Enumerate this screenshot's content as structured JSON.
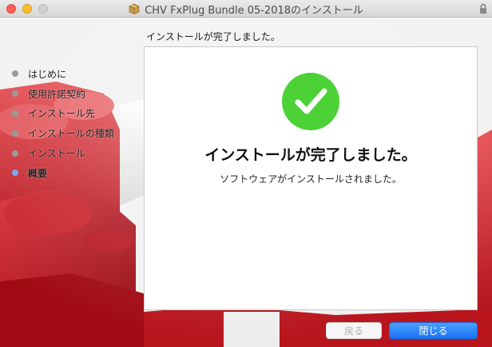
{
  "window": {
    "title": "CHV FxPlug Bundle 05-2018のインストール"
  },
  "colors": {
    "accent": "#1a72f6",
    "success": "#4cd137",
    "brand_red": "#c8141e",
    "active_dot": "#7aa7f5"
  },
  "header": {
    "step_title": "インストールが完了しました。"
  },
  "sidebar": {
    "items": [
      {
        "label": "はじめに",
        "active": false
      },
      {
        "label": "使用許諾契約",
        "active": false
      },
      {
        "label": "インストール先",
        "active": false
      },
      {
        "label": "インストールの種類",
        "active": false
      },
      {
        "label": "インストール",
        "active": false
      },
      {
        "label": "概要",
        "active": true
      }
    ]
  },
  "main": {
    "status_icon": "checkmark-circle-icon",
    "headline": "インストールが完了しました。",
    "message": "ソフトウェアがインストールされました。"
  },
  "buttons": {
    "back_label": "戻る",
    "back_enabled": false,
    "close_label": "閉じる"
  }
}
